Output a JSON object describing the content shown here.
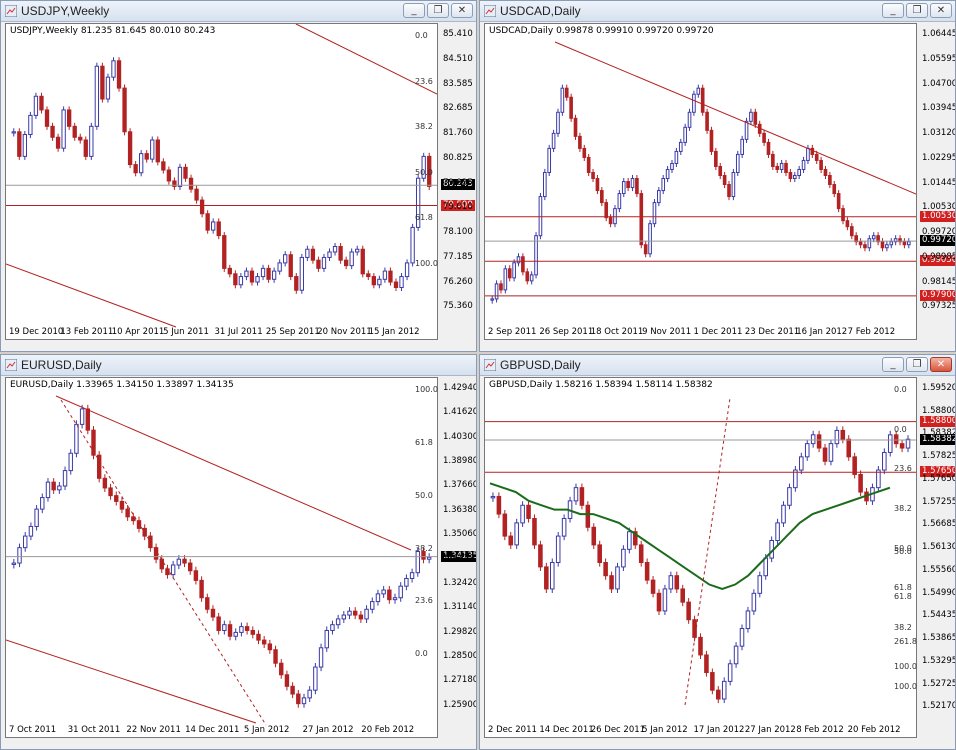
{
  "colors": {
    "bull": "#3a3aa8",
    "bear": "#b22222",
    "trend": "#b22222",
    "level": "#b22222",
    "fib": "#444444",
    "ma": "#1a6b1a"
  },
  "icons": {
    "title": "chart-window-icon",
    "minimize": "minimize-icon",
    "restore": "restore-icon",
    "close": "close-icon"
  },
  "windows": [
    {
      "id": "usdjpy",
      "title": "USDJPY,Weekly",
      "info": "USDJPY,Weekly  81.235 81.645 80.010 80.243",
      "yticks": [
        "85.410",
        "84.510",
        "83.585",
        "82.685",
        "81.760",
        "80.825",
        "79.935",
        "79.010",
        "78.100",
        "77.185",
        "76.260",
        "75.360"
      ],
      "xticks": [
        "19 Dec 2010",
        "13 Feb 2011",
        "10 Apr 2011",
        "5 Jun 2011",
        "31 Jul 2011",
        "25 Sep 2011",
        "20 Nov 2011",
        "15 Jan 2012"
      ],
      "price_labels": [
        {
          "text": "80.243",
          "style": "black"
        },
        {
          "text": "79.500",
          "style": "red"
        }
      ],
      "fibs": [
        "0.0",
        "23.6",
        "38.2",
        "50.0",
        "61.8",
        "100.0"
      ],
      "series": [
        82.2,
        81.3,
        82.1,
        82.8,
        83.5,
        83.0,
        82.4,
        82.0,
        81.6,
        83.0,
        82.4,
        82.0,
        81.9,
        81.3,
        82.4,
        84.6,
        83.4,
        84.2,
        84.8,
        83.8,
        82.2,
        81.0,
        80.7,
        81.4,
        81.2,
        81.9,
        81.1,
        80.8,
        80.4,
        80.2,
        80.9,
        80.5,
        80.1,
        79.7,
        79.2,
        78.6,
        78.9,
        78.4,
        77.2,
        77.0,
        76.6,
        76.9,
        77.1,
        76.7,
        76.9,
        77.2,
        76.8,
        77.1,
        77.4,
        77.7,
        76.9,
        76.4,
        77.6,
        77.9,
        77.5,
        77.2,
        77.6,
        77.8,
        78.0,
        77.5,
        77.3,
        77.8,
        77.9,
        77.0,
        76.9,
        76.6,
        76.8,
        77.1,
        76.7,
        76.5,
        76.9,
        77.4,
        78.7,
        80.5,
        81.3,
        80.2
      ],
      "ylim": [
        75.2,
        86.0
      ]
    },
    {
      "id": "usdcad",
      "title": "USDCAD,Daily",
      "info": "USDCAD,Daily  0.99878 0.99910 0.99720 0.99720",
      "yticks": [
        "1.06445",
        "1.05595",
        "1.04700",
        "1.03945",
        "1.03120",
        "1.02295",
        "1.01445",
        "1.00530",
        "0.99720",
        "0.98985",
        "0.98145",
        "0.97325"
      ],
      "xticks": [
        "2 Sep 2011",
        "26 Sep 2011",
        "18 Oct 2011",
        "9 Nov 2011",
        "1 Dec 2011",
        "23 Dec 2011",
        "16 Jan 2012",
        "7 Feb 2012"
      ],
      "price_labels": [
        {
          "text": "1.00530",
          "style": "red"
        },
        {
          "text": "0.99720",
          "style": "black"
        },
        {
          "text": "0.99050",
          "style": "red"
        },
        {
          "text": "0.97900",
          "style": "red"
        }
      ],
      "series": [
        0.978,
        0.983,
        0.981,
        0.988,
        0.985,
        0.99,
        0.992,
        0.987,
        0.984,
        0.986,
        0.999,
        1.012,
        1.02,
        1.028,
        1.033,
        1.04,
        1.048,
        1.045,
        1.038,
        1.032,
        1.028,
        1.025,
        1.02,
        1.018,
        1.014,
        1.01,
        1.005,
        1.003,
        1.008,
        1.013,
        1.017,
        1.015,
        1.018,
        1.013,
        0.996,
        0.993,
        1.003,
        1.01,
        1.014,
        1.018,
        1.021,
        1.023,
        1.027,
        1.03,
        1.035,
        1.04,
        1.046,
        1.048,
        1.04,
        1.034,
        1.027,
        1.022,
        1.019,
        1.016,
        1.012,
        1.02,
        1.026,
        1.031,
        1.037,
        1.04,
        1.036,
        1.033,
        1.03,
        1.026,
        1.022,
        1.021,
        1.023,
        1.02,
        1.018,
        1.019,
        1.021,
        1.024,
        1.028,
        1.026,
        1.024,
        1.021,
        1.019,
        1.016,
        1.013,
        1.008,
        1.004,
        1.002,
        0.999,
        0.997,
        0.996,
        0.995,
        0.998,
        0.999,
        0.997,
        0.995,
        0.996,
        0.997,
        0.998,
        0.997,
        0.996,
        0.997
      ],
      "ylim": [
        0.97,
        1.068
      ]
    },
    {
      "id": "eurusd",
      "title": "EURUSD,Daily",
      "info": "EURUSD,Daily  1.33965 1.34150 1.33897 1.34135",
      "yticks": [
        "1.42940",
        "1.41620",
        "1.40300",
        "1.38980",
        "1.37660",
        "1.36380",
        "1.35060",
        "1.33740",
        "1.32420",
        "1.31140",
        "1.29820",
        "1.28500",
        "1.27180",
        "1.25900"
      ],
      "xticks": [
        "7 Oct 2011",
        "31 Oct 2011",
        "22 Nov 2011",
        "14 Dec 2011",
        "5 Jan 2012",
        "27 Jan 2012",
        "20 Feb 2012"
      ],
      "price_labels": [
        {
          "text": "1.34135",
          "style": "black"
        }
      ],
      "fibs": [
        "100.0",
        "61.8",
        "50.0",
        "38.2",
        "23.6",
        "0.0"
      ],
      "series": [
        1.338,
        1.346,
        1.352,
        1.357,
        1.366,
        1.372,
        1.38,
        1.376,
        1.378,
        1.386,
        1.395,
        1.41,
        1.418,
        1.407,
        1.394,
        1.382,
        1.377,
        1.373,
        1.37,
        1.366,
        1.362,
        1.36,
        1.356,
        1.352,
        1.346,
        1.34,
        1.335,
        1.332,
        1.337,
        1.34,
        1.338,
        1.334,
        1.329,
        1.32,
        1.314,
        1.31,
        1.303,
        1.306,
        1.3,
        1.302,
        1.305,
        1.303,
        1.301,
        1.298,
        1.296,
        1.293,
        1.286,
        1.28,
        1.274,
        1.27,
        1.265,
        1.268,
        1.272,
        1.284,
        1.294,
        1.303,
        1.306,
        1.309,
        1.311,
        1.313,
        1.311,
        1.309,
        1.314,
        1.318,
        1.322,
        1.324,
        1.319,
        1.32,
        1.326,
        1.33,
        1.333,
        1.344,
        1.34,
        1.341
      ],
      "ylim": [
        1.256,
        1.432
      ]
    },
    {
      "id": "gbpusd",
      "title": "GBPUSD,Daily",
      "info": "GBPUSD,Daily  1.58216 1.58394 1.58114 1.58382",
      "yticks": [
        "1.59520",
        "1.58800",
        "1.58382",
        "1.57825",
        "1.57650",
        "1.57255",
        "1.56685",
        "1.56130",
        "1.55560",
        "1.54990",
        "1.54435",
        "1.53865",
        "1.53295",
        "1.52725",
        "1.52170"
      ],
      "xticks": [
        "2 Dec 2011",
        "14 Dec 2011",
        "26 Dec 2011",
        "5 Jan 2012",
        "17 Jan 2012",
        "27 Jan 2012",
        "8 Feb 2012",
        "20 Feb 2012"
      ],
      "price_labels": [
        {
          "text": "1.58800",
          "style": "red"
        },
        {
          "text": "1.58382",
          "style": "black"
        },
        {
          "text": "1.57650",
          "style": "red"
        }
      ],
      "fibs_top": [
        "0.0",
        "0.0",
        "23.6",
        "38.2",
        "50.0",
        "61.8",
        "38.2",
        "100.0"
      ],
      "fibs_bottom": [
        "50.0",
        "61.8",
        "261.8",
        "100.0"
      ],
      "series": [
        1.571,
        1.567,
        1.562,
        1.56,
        1.565,
        1.569,
        1.566,
        1.56,
        1.555,
        1.55,
        1.556,
        1.562,
        1.566,
        1.57,
        1.573,
        1.569,
        1.564,
        1.56,
        1.556,
        1.553,
        1.55,
        1.555,
        1.559,
        1.563,
        1.56,
        1.556,
        1.552,
        1.549,
        1.545,
        1.55,
        1.553,
        1.55,
        1.547,
        1.543,
        1.539,
        1.535,
        1.531,
        1.527,
        1.525,
        1.529,
        1.533,
        1.537,
        1.541,
        1.545,
        1.549,
        1.553,
        1.557,
        1.561,
        1.565,
        1.569,
        1.573,
        1.577,
        1.58,
        1.583,
        1.585,
        1.582,
        1.579,
        1.583,
        1.586,
        1.584,
        1.58,
        1.576,
        1.572,
        1.57,
        1.573,
        1.577,
        1.581,
        1.585,
        1.583,
        1.582,
        1.584
      ],
      "ma": [
        1.574,
        1.573,
        1.572,
        1.57,
        1.569,
        1.568,
        1.568,
        1.567,
        1.567,
        1.566,
        1.565,
        1.563,
        1.561,
        1.559,
        1.557,
        1.555,
        1.553,
        1.551,
        1.55,
        1.551,
        1.553,
        1.556,
        1.559,
        1.562,
        1.565,
        1.567,
        1.568,
        1.569,
        1.57,
        1.571,
        1.572,
        1.573
      ],
      "ylim": [
        1.52,
        1.597
      ]
    }
  ]
}
